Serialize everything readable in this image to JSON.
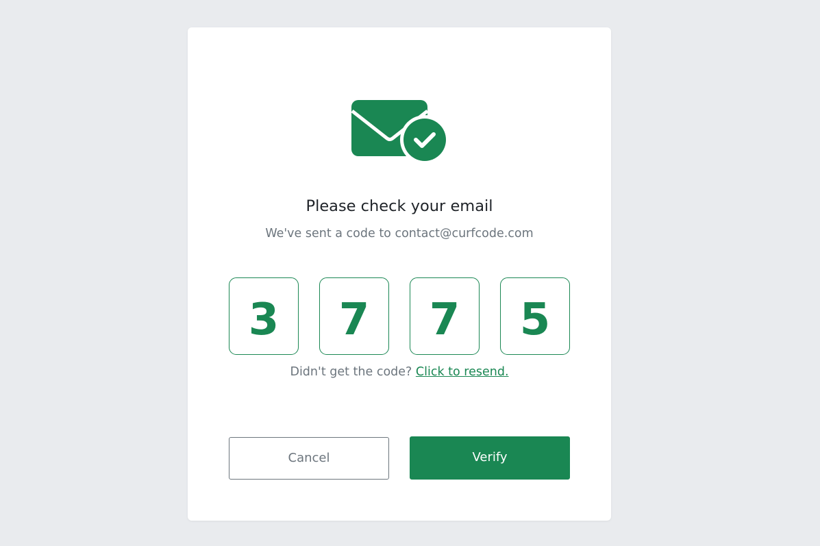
{
  "dialog": {
    "icon": "mail-check-icon",
    "title": "Please check your email",
    "subtitle": "We've sent a code to contact@curfcode.com",
    "code_digits": [
      "3",
      "7",
      "7",
      "5"
    ],
    "resend_prompt": "Didn't get the code?",
    "resend_link": "Click to resend.",
    "cancel_label": "Cancel",
    "verify_label": "Verify"
  },
  "colors": {
    "accent": "#1a8753",
    "background": "#e9ebee",
    "card": "#ffffff",
    "muted_text": "#6c757d"
  }
}
